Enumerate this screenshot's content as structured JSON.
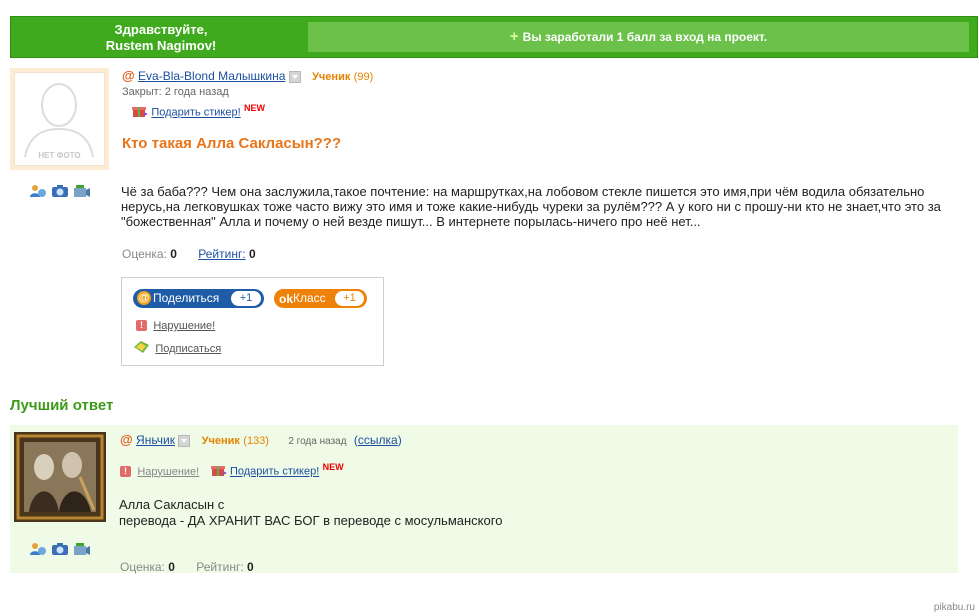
{
  "topbar": {
    "greeting": "Здравствуйте,",
    "username": "Rustem Nagimov!",
    "bonus_plus": "+",
    "bonus_text": "Вы заработали 1 балл за вход на проект."
  },
  "question": {
    "photo_placeholder": "НЕТ ФОТО",
    "at_symbol": "@",
    "author": "Eva-Bla-Blond Малышкина",
    "status": "Ученик",
    "status_count": "(99)",
    "closed": "Закрыт: 2 года назад",
    "gift_sticker": "Подарить стикер!",
    "new_badge": "NEW",
    "title": "Кто такая Алла Сакласын???",
    "body": "Чё за баба??? Чем она заслужила,такое почтение: на маршрутках,на лобовом стекле пишется это имя,при чём водила обязательно нерусь,на легковушках тоже часто вижу это имя и тоже какие-нибудь чуреки за рулём??? А у кого ни с прошу-ни кто не знает,что это за \"божественная\" Алла и почему о ней везде пишут... В интернете порылась-ничего про неё нет...",
    "score_label": "Оценка:",
    "score_value": "0",
    "rating_label": "Рейтинг:",
    "rating_value": "0"
  },
  "share": {
    "share_label": "Поделиться",
    "share_count": "+1",
    "class_label": "Класс",
    "class_count": "+1",
    "violation": "Нарушение!",
    "subscribe": "Подписаться"
  },
  "best_answer": {
    "section_title": "Лучший ответ",
    "at_symbol": "@",
    "author": "Яньчик",
    "status": "Ученик",
    "status_count": "(133)",
    "time": "2 года назад",
    "link_open": "(",
    "link_text": "ссылка",
    "link_close": ")",
    "violation": "Нарушение!",
    "gift_sticker": "Подарить стикер!",
    "new_badge": "NEW",
    "body_line1": "Алла Сакласын с",
    "body_line2": "перевода - ДА ХРАНИТ ВАС БОГ в переводе с мосульманского",
    "score_label": "Оценка:",
    "score_value": "0",
    "rating_label": "Рейтинг:",
    "rating_value": "0"
  },
  "footer": {
    "watermark": "pikabu.ru"
  },
  "colors": {
    "brand_green": "#3faa1d",
    "accent_orange": "#e8751a",
    "link_blue": "#1d4fa0",
    "answer_bg": "#effbe6"
  },
  "icons": [
    "user-icon",
    "camera-icon",
    "video-icon",
    "gift-icon",
    "warning-icon",
    "subscribe-icon"
  ]
}
